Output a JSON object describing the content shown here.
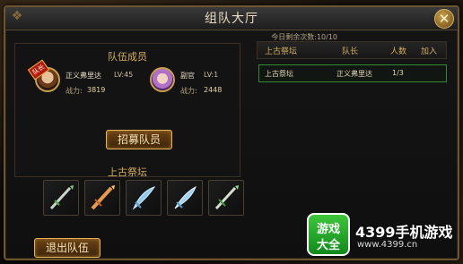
{
  "window": {
    "title": "组队大厅",
    "close_symbol": "✕"
  },
  "remaining": "今日剩余次数:10/10",
  "members": {
    "section_title": "队伍成员",
    "list": [
      {
        "name": "正义弗里达",
        "level": "LV:45",
        "power_label": "战力:",
        "power": "3819",
        "leader_tag": "队长"
      },
      {
        "name": "副官",
        "level": "LV:1",
        "power_label": "战力:",
        "power": "2448"
      }
    ]
  },
  "recruit_label": "招募队员",
  "altar": {
    "title": "上古祭坛",
    "weapons": [
      "spear-icon",
      "fire-sword-icon",
      "ice-blade-icon",
      "ice-blade-icon",
      "green-sword-icon"
    ]
  },
  "leave_label": "退出队伍",
  "teams_table": {
    "headers": [
      "上古祭坛",
      "队长",
      "人数",
      "加入"
    ],
    "rows": [
      {
        "altar": "上古祭坛",
        "leader": "正义弗里达",
        "count": "1/3"
      }
    ]
  },
  "watermark": {
    "logo_line1": "游戏",
    "logo_line2": "大全",
    "brand": "4399手机游戏",
    "url": "www.4399.cn"
  },
  "colors": {
    "accent_gold": "#d3ad5c",
    "row_highlight": "#2f8a30"
  }
}
